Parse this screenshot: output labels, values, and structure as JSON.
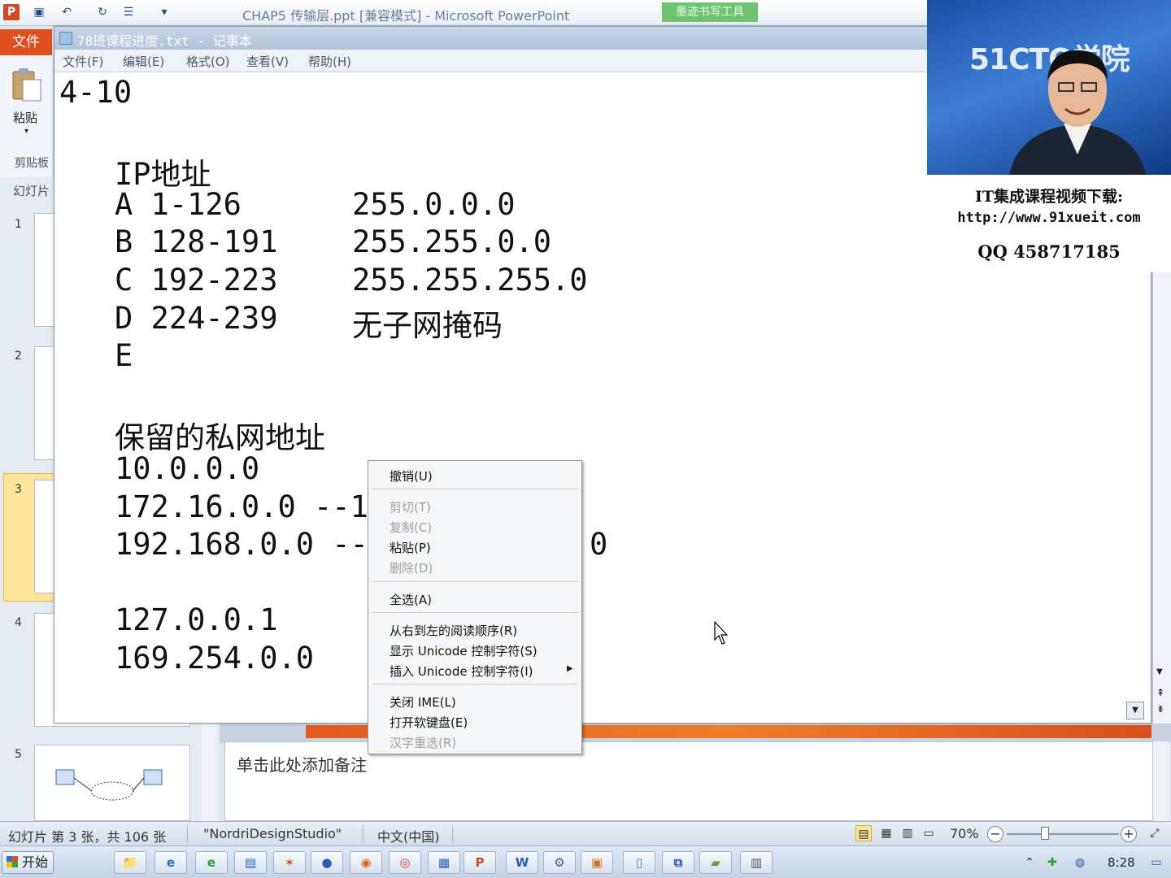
{
  "ppt": {
    "title": "CHAP5 传输层.ppt [兼容模式] - Microsoft PowerPoint",
    "ink_tools": "墨迹书写工具",
    "file_tab": "文件",
    "paste_label": "粘贴",
    "clipboard_label": "剪贴板",
    "slides_tab": "幻灯片",
    "slide_numbers": [
      "1",
      "2",
      "3",
      "4",
      "5"
    ],
    "notes_placeholder": "单击此处添加备注"
  },
  "statusbar": {
    "slide_info": "幻灯片 第 3 张，共 106 张",
    "theme": "\"NordriDesignStudio\"",
    "language": "中文(中国)",
    "zoom": "70%"
  },
  "notepad": {
    "title": "78班课程进度.txt - 记事本",
    "menu": [
      "文件(F)",
      "编辑(E)",
      "格式(O)",
      "查看(V)",
      "帮助(H)"
    ],
    "lines": {
      "l1": "4-10",
      "l2": "IP地址",
      "l3a": "A 1-126",
      "l3b": "255.0.0.0",
      "l4a": "B 128-191",
      "l4b": "255.255.0.0",
      "l5a": "C 192-223",
      "l5b": "255.255.255.0",
      "l6a": "D 224-239",
      "l6b": "无子网掩码",
      "l7": "E",
      "l8": "保留的私网地址",
      "l9": "10.0.0.0",
      "l10": "172.16.0.0 --1",
      "l11a": "192.168.0.0 --",
      "l11b": "0",
      "l12": "127.0.0.1",
      "l13": "169.254.0.0"
    }
  },
  "context_menu": {
    "undo": "撤销(U)",
    "cut": "剪切(T)",
    "copy": "复制(C)",
    "paste": "粘贴(P)",
    "delete": "删除(D)",
    "select_all": "全选(A)",
    "rtl": "从右到左的阅读顺序(R)",
    "show_unicode": "显示 Unicode 控制字符(S)",
    "insert_unicode": "插入 Unicode 控制字符(I)",
    "close_ime": "关闭 IME(L)",
    "soft_keyboard": "打开软键盘(E)",
    "reconvert": "汉字重选(R)"
  },
  "overlay": {
    "logo": "51CTO学院",
    "promo_line1": "IT集成课程视频下载:",
    "promo_line2": "http://www.91xueit.com",
    "promo_line3": "QQ 458717185"
  },
  "taskbar": {
    "start": "开始",
    "clock": "8:28"
  },
  "colors": {
    "ppt_accent": "#d24726",
    "ink_tools": "#6fc36f",
    "selected_thumb": "#fde59b"
  }
}
